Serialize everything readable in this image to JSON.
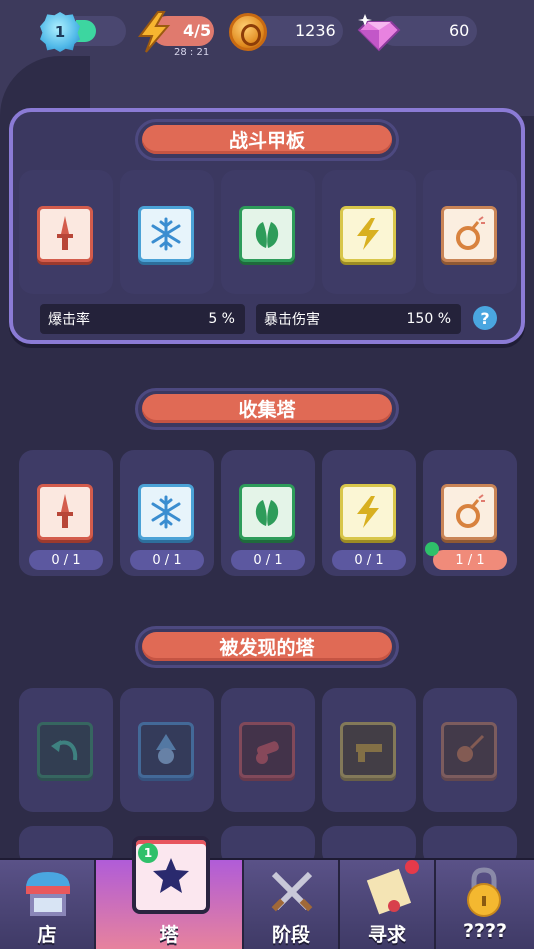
{
  "header": {
    "level": "1",
    "energy": "4/5",
    "energy_timer": "28 : 21",
    "coins": "1236",
    "gems": "60"
  },
  "battle_deck": {
    "title": "战斗甲板",
    "slots": [
      {
        "icon": "dagger-icon",
        "color": "red"
      },
      {
        "icon": "snowflake-icon",
        "color": "blue"
      },
      {
        "icon": "leaf-icon",
        "color": "green"
      },
      {
        "icon": "lightning-icon",
        "color": "yellow"
      },
      {
        "icon": "bomb-icon",
        "color": "orange"
      }
    ],
    "crit_rate_label": "爆击率",
    "crit_rate_value": "5 %",
    "crit_damage_label": "暴击伤害",
    "crit_damage_value": "150 %",
    "help": "?"
  },
  "collection": {
    "title": "收集塔",
    "slots": [
      {
        "icon": "dagger-icon",
        "count": "0 / 1"
      },
      {
        "icon": "snowflake-icon",
        "count": "0 / 1"
      },
      {
        "icon": "leaf-icon",
        "count": "0 / 1"
      },
      {
        "icon": "lightning-icon",
        "count": "0 / 1"
      },
      {
        "icon": "bomb-icon",
        "count": "1 / 1"
      }
    ]
  },
  "discovered": {
    "title": "被发现的塔",
    "slots": [
      {
        "icon": "return-arrow-icon"
      },
      {
        "icon": "wizard-icon"
      },
      {
        "icon": "cannon-icon"
      },
      {
        "icon": "gun-icon"
      },
      {
        "icon": "meteor-icon"
      }
    ]
  },
  "nav": {
    "shop": "店",
    "tower": "塔",
    "tower_badge": "1",
    "stage": "阶段",
    "quest": "寻求",
    "locked": "????"
  },
  "colors": {
    "accent": "#e06a55",
    "panel_border": "#8b7bd6",
    "background": "#2e2c48"
  }
}
